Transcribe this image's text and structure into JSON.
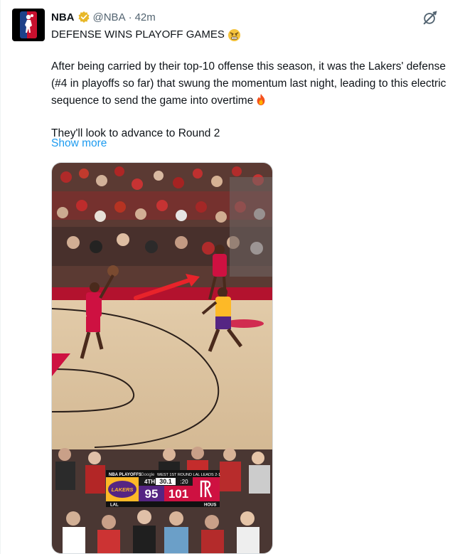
{
  "tweet": {
    "author_name": "NBA",
    "handle": "@NBA",
    "separator": "·",
    "time": "42m",
    "headline": "DEFENSE WINS PLAYOFF GAMES",
    "body_line_1": "After being carried by their top-10 offense this season, it was the Lakers' defense (#4 in playoffs so far) that swung the momentum last night, leading to this electric sequence to send the game into overtime",
    "body_line_2": "They'll look to advance to Round 2",
    "show_more": "Show more"
  },
  "scorebug": {
    "header_left": "NBA PLAYOFFS",
    "header_mid": "Google",
    "header_round": "WEST 1ST ROUND LAL LEADS 2-1",
    "quarter": "4TH",
    "clock": "30.1",
    "shot_clock": ":20",
    "away_team": "LAKERS",
    "away_score": "95",
    "home_score": "101",
    "away_abbr": "LAL",
    "home_abbr": "HOUS"
  },
  "colors": {
    "verified_gold": "#e8b829",
    "link_blue": "#1d9bf0",
    "rockets_red": "#ce1141",
    "lakers_gold": "#fdb927",
    "lakers_purple": "#552583"
  },
  "icons": {
    "verified": "verified-gold-badge-icon",
    "grok": "grok-icon",
    "angry_emoji": "angry-face-emoji-icon",
    "fire_emoji": "fire-emoji-icon"
  }
}
